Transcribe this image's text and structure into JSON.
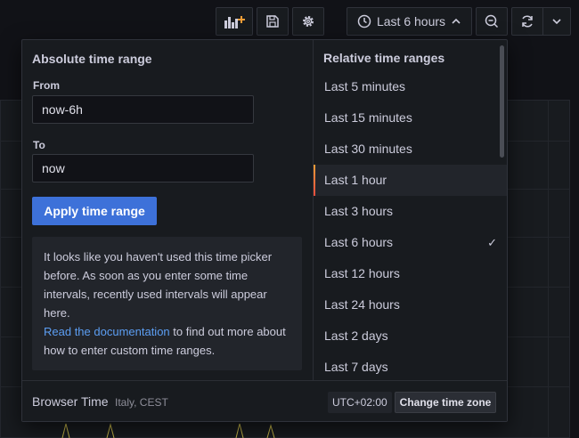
{
  "toolbar": {
    "time_range_label": "Last 6 hours"
  },
  "picker": {
    "absolute": {
      "title": "Absolute time range",
      "from_label": "From",
      "from_value": "now-6h",
      "to_label": "To",
      "to_value": "now",
      "apply_label": "Apply time range",
      "help_text": "It looks like you haven't used this time picker before. As soon as you enter some time intervals, recently used intervals will appear here.",
      "help_link": "Read the documentation",
      "help_suffix": " to find out more about how to enter custom time ranges."
    },
    "relative": {
      "title": "Relative time ranges",
      "items": [
        {
          "label": "Last 5 minutes"
        },
        {
          "label": "Last 15 minutes"
        },
        {
          "label": "Last 30 minutes"
        },
        {
          "label": "Last 1 hour"
        },
        {
          "label": "Last 3 hours"
        },
        {
          "label": "Last 6 hours"
        },
        {
          "label": "Last 12 hours"
        },
        {
          "label": "Last 24 hours"
        },
        {
          "label": "Last 2 days"
        },
        {
          "label": "Last 7 days"
        }
      ],
      "hovered": "Last 1 hour",
      "selected": "Last 6 hours"
    },
    "footer": {
      "browser_time_label": "Browser Time",
      "timezone_name": "Italy, CEST",
      "utc_offset": "UTC+02:00",
      "change_tz_label": "Change time zone"
    }
  },
  "colors": {
    "accent_blue": "#3d71d9",
    "link_blue": "#5c9ef3",
    "active_marker": "#f59e37",
    "add_panel_icon": "#f59e37"
  },
  "icons": [
    "add-panel-icon",
    "save-icon",
    "settings-gear-icon",
    "clock-icon",
    "chevron-up-icon",
    "zoom-out-icon",
    "refresh-icon",
    "chevron-down-icon",
    "checkmark-icon"
  ]
}
